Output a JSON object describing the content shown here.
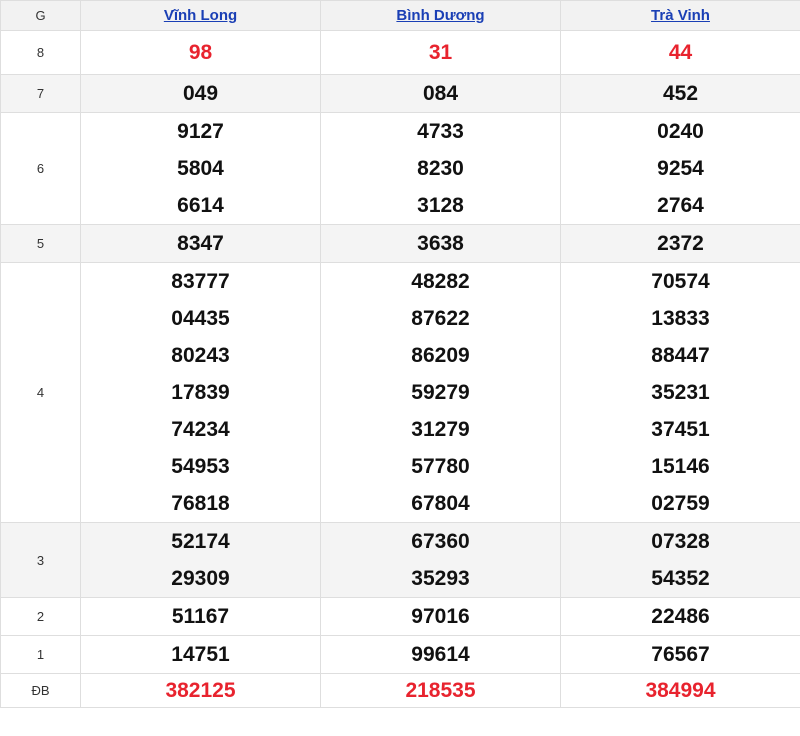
{
  "header": {
    "g_label": "G",
    "provinces": [
      "Vĩnh Long",
      "Bình Dương",
      "Trà Vinh"
    ]
  },
  "rows": [
    {
      "label": "8",
      "values": [
        [
          "98"
        ],
        [
          "31"
        ],
        [
          "44"
        ]
      ]
    },
    {
      "label": "7",
      "values": [
        [
          "049"
        ],
        [
          "084"
        ],
        [
          "452"
        ]
      ]
    },
    {
      "label": "6",
      "values": [
        [
          "9127",
          "5804",
          "6614"
        ],
        [
          "4733",
          "8230",
          "3128"
        ],
        [
          "0240",
          "9254",
          "2764"
        ]
      ]
    },
    {
      "label": "5",
      "values": [
        [
          "8347"
        ],
        [
          "3638"
        ],
        [
          "2372"
        ]
      ]
    },
    {
      "label": "4",
      "values": [
        [
          "83777",
          "04435",
          "80243",
          "17839",
          "74234",
          "54953",
          "76818"
        ],
        [
          "48282",
          "87622",
          "86209",
          "59279",
          "31279",
          "57780",
          "67804"
        ],
        [
          "70574",
          "13833",
          "88447",
          "35231",
          "37451",
          "15146",
          "02759"
        ]
      ]
    },
    {
      "label": "3",
      "values": [
        [
          "52174",
          "29309"
        ],
        [
          "67360",
          "35293"
        ],
        [
          "07328",
          "54352"
        ]
      ]
    },
    {
      "label": "2",
      "values": [
        [
          "51167"
        ],
        [
          "97016"
        ],
        [
          "22486"
        ]
      ]
    },
    {
      "label": "1",
      "values": [
        [
          "14751"
        ],
        [
          "99614"
        ],
        [
          "76567"
        ]
      ]
    },
    {
      "label": "ĐB",
      "values": [
        [
          "382125"
        ],
        [
          "218535"
        ],
        [
          "384994"
        ]
      ]
    }
  ],
  "colors": {
    "highlight_red": "#e8232e",
    "link_blue": "#1a3fb5",
    "number_black": "#111111"
  }
}
